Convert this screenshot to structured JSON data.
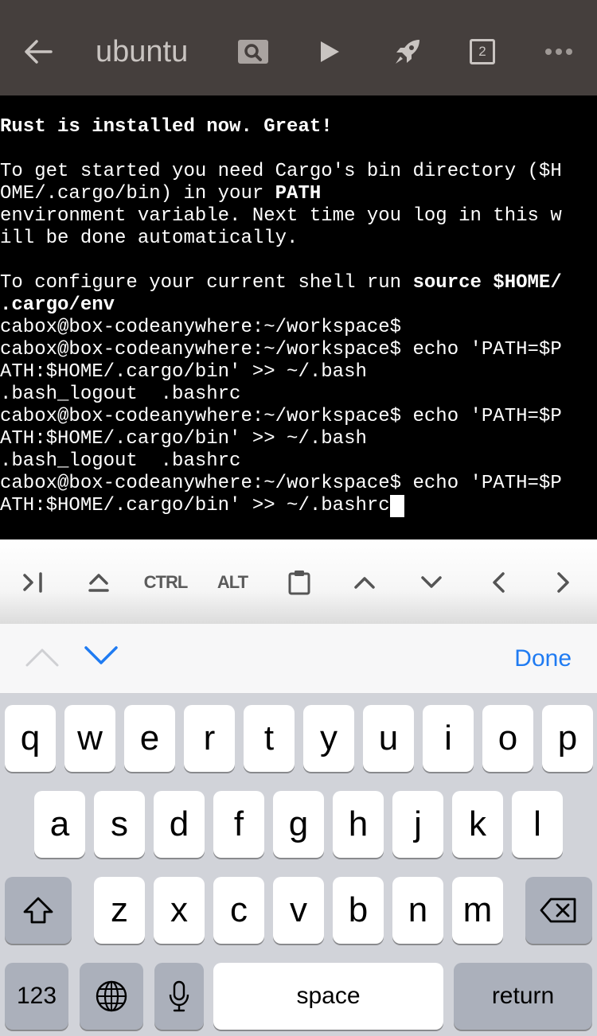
{
  "topbar": {
    "title": "ubuntu",
    "tab_count": "2",
    "icons": [
      "back-arrow-icon",
      "search-icon",
      "play-icon",
      "rocket-icon",
      "tabs-icon",
      "more-icon"
    ],
    "background": "#453f3d"
  },
  "terminal": {
    "lines": [
      {
        "segments": [
          {
            "text": "Rust is installed now. Great!",
            "bold": true
          }
        ]
      },
      {
        "segments": [
          {
            "text": "",
            "bold": false
          }
        ]
      },
      {
        "segments": [
          {
            "text": "To get started you need Cargo's bin directory ($H",
            "bold": false
          }
        ]
      },
      {
        "segments": [
          {
            "text": "OME/.cargo/bin) in your ",
            "bold": false
          },
          {
            "text": "PATH",
            "bold": true
          }
        ]
      },
      {
        "segments": [
          {
            "text": "environment variable. Next time you log in this w",
            "bold": false
          }
        ]
      },
      {
        "segments": [
          {
            "text": "ill be done automatically.",
            "bold": false
          }
        ]
      },
      {
        "segments": [
          {
            "text": "",
            "bold": false
          }
        ]
      },
      {
        "segments": [
          {
            "text": "To configure your current shell run ",
            "bold": false
          },
          {
            "text": "source $HOME/",
            "bold": true
          }
        ]
      },
      {
        "segments": [
          {
            "text": ".cargo/env",
            "bold": true
          }
        ]
      },
      {
        "segments": [
          {
            "text": "cabox@box-codeanywhere:~/workspace$",
            "bold": false
          }
        ]
      },
      {
        "segments": [
          {
            "text": "cabox@box-codeanywhere:~/workspace$ echo 'PATH=$P",
            "bold": false
          }
        ]
      },
      {
        "segments": [
          {
            "text": "ATH:$HOME/.cargo/bin' >> ~/.bash",
            "bold": false
          }
        ]
      },
      {
        "segments": [
          {
            "text": ".bash_logout  .bashrc",
            "bold": false
          }
        ]
      },
      {
        "segments": [
          {
            "text": "cabox@box-codeanywhere:~/workspace$ echo 'PATH=$P",
            "bold": false
          }
        ]
      },
      {
        "segments": [
          {
            "text": "ATH:$HOME/.cargo/bin' >> ~/.bash",
            "bold": false
          }
        ]
      },
      {
        "segments": [
          {
            "text": ".bash_logout  .bashrc",
            "bold": false
          }
        ]
      },
      {
        "segments": [
          {
            "text": "cabox@box-codeanywhere:~/workspace$ echo 'PATH=$P",
            "bold": false
          }
        ]
      },
      {
        "segments": [
          {
            "text": "ATH:$HOME/.cargo/bin' >> ~/.bashrc",
            "bold": false
          }
        ],
        "cursor": true
      }
    ]
  },
  "accessory_bar": {
    "keys": [
      {
        "name": "tab-key",
        "icon": "tab-icon"
      },
      {
        "name": "eject-key",
        "icon": "hide-keyboard-icon"
      },
      {
        "name": "ctrl-key",
        "label": "CTRL"
      },
      {
        "name": "alt-key",
        "label": "ALT"
      },
      {
        "name": "paste-key",
        "icon": "clipboard-icon"
      },
      {
        "name": "arrow-up-key",
        "icon": "chevron-up-icon"
      },
      {
        "name": "arrow-down-key",
        "icon": "chevron-down-icon"
      },
      {
        "name": "arrow-left-key",
        "icon": "chevron-left-icon"
      },
      {
        "name": "arrow-right-key",
        "icon": "chevron-right-icon"
      }
    ]
  },
  "keyboard_toolbar": {
    "done_label": "Done",
    "accent": "#1f7bf2"
  },
  "keyboard": {
    "row1": [
      "q",
      "w",
      "e",
      "r",
      "t",
      "y",
      "u",
      "i",
      "o",
      "p"
    ],
    "row2": [
      "a",
      "s",
      "d",
      "f",
      "g",
      "h",
      "j",
      "k",
      "l"
    ],
    "row3": [
      "z",
      "x",
      "c",
      "v",
      "b",
      "n",
      "m"
    ],
    "numbers_label": "123",
    "space_label": "space",
    "return_label": "return"
  }
}
